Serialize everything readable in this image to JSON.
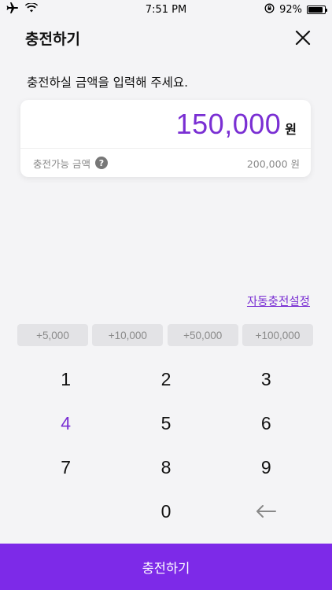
{
  "status_bar": {
    "time": "7:51 PM",
    "battery": "92%",
    "battery_level": 0.92,
    "icons": [
      "airplane-icon",
      "wifi-icon",
      "rotation-lock-icon",
      "battery-icon"
    ]
  },
  "header": {
    "title": "충전하기",
    "close_icon": "close-icon"
  },
  "instruction": "충전하실 금액을 입력해 주세요.",
  "amount": {
    "value": "150,000",
    "unit": "원",
    "limit_label": "충전가능 금액",
    "limit_value": "200,000 원"
  },
  "auto_charge_link": "자동충전설정",
  "quick_add": [
    "+5,000",
    "+10,000",
    "+50,000",
    "+100,000"
  ],
  "keypad": {
    "keys": [
      "1",
      "2",
      "3",
      "4",
      "5",
      "6",
      "7",
      "8",
      "9",
      "",
      "0",
      "←"
    ],
    "active_key": "4"
  },
  "submit_label": "충전하기",
  "colors": {
    "accent": "#7a2fd3",
    "button": "#7d2ae8",
    "background": "#f4f4f6"
  }
}
